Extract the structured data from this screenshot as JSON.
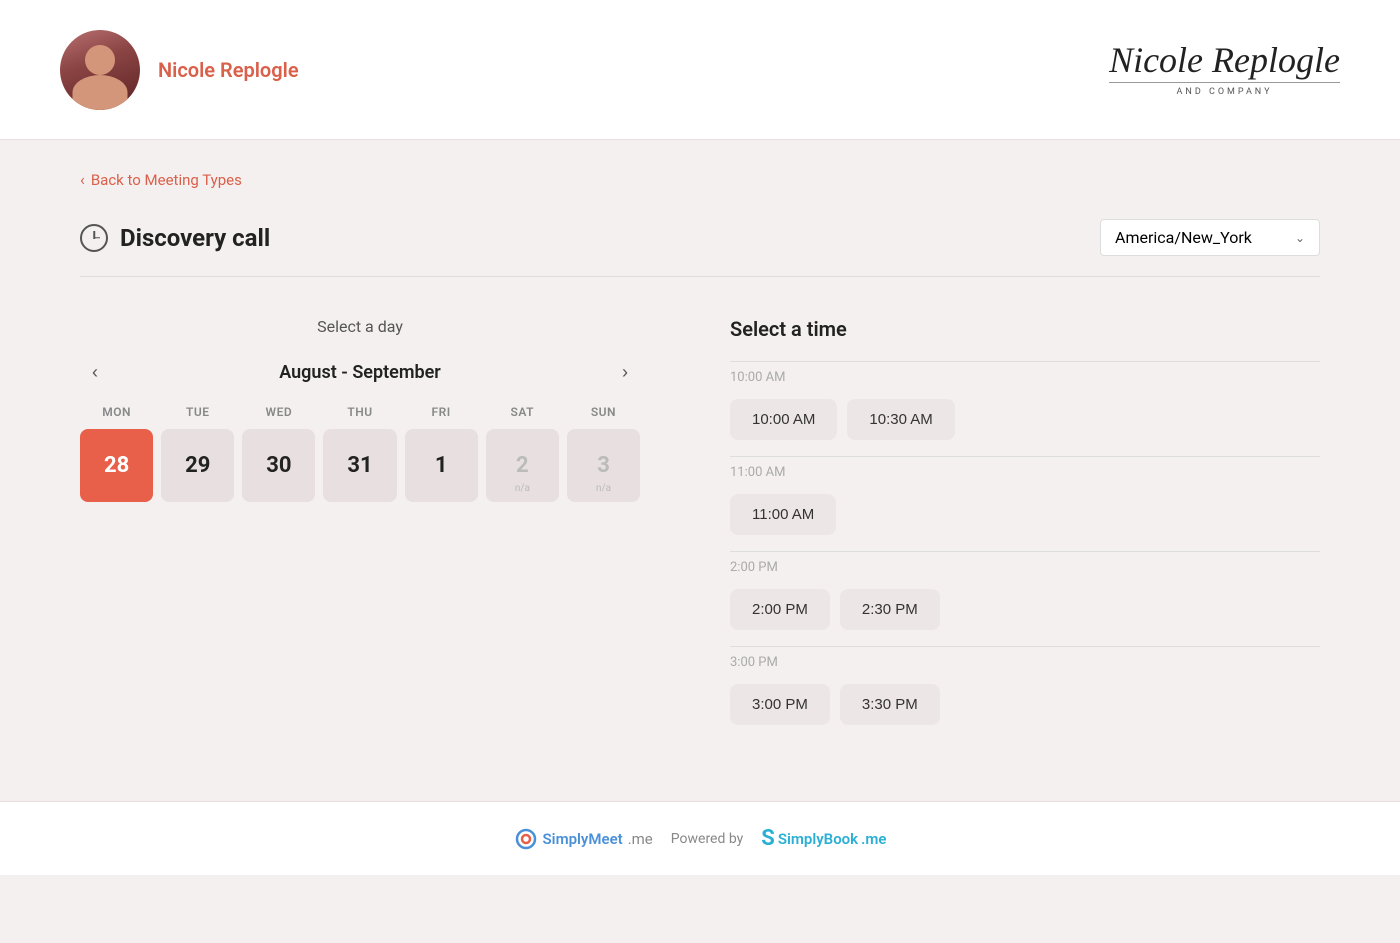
{
  "header": {
    "user_name": "Nicole Replogle",
    "logo_line1": "Nicole Replogle",
    "logo_line2": "AND COMPANY"
  },
  "navigation": {
    "back_label": "Back to Meeting Types"
  },
  "meeting": {
    "title": "Discovery call",
    "timezone_label": "America/New_York"
  },
  "calendar": {
    "select_day_label": "Select a day",
    "month_label": "August - September",
    "weekdays": [
      "MON",
      "TUE",
      "WED",
      "THU",
      "FRI",
      "SAT",
      "SUN"
    ],
    "days": [
      {
        "num": "28",
        "active": true,
        "na": false
      },
      {
        "num": "29",
        "active": false,
        "na": false
      },
      {
        "num": "30",
        "active": false,
        "na": false
      },
      {
        "num": "31",
        "active": false,
        "na": false
      },
      {
        "num": "1",
        "active": false,
        "na": false
      },
      {
        "num": "2",
        "active": false,
        "na": true
      },
      {
        "num": "3",
        "active": false,
        "na": true
      }
    ]
  },
  "time_picker": {
    "select_time_label": "Select a time",
    "groups": [
      {
        "header": "10:00 AM",
        "slots": [
          "10:00 AM",
          "10:30 AM"
        ]
      },
      {
        "header": "11:00 AM",
        "slots": [
          "11:00 AM"
        ]
      },
      {
        "header": "2:00 PM",
        "slots": [
          "2:00 PM",
          "2:30 PM"
        ]
      },
      {
        "header": "3:00 PM",
        "slots": [
          "3:00 PM",
          "3:30 PM"
        ]
      }
    ]
  },
  "footer": {
    "simplymeet_brand": "SimplyMeet",
    "simplymeet_suffix": ".me",
    "powered_by": "Powered by",
    "simplybook_brand": "SimplyBook",
    "simplybook_suffix": ".me"
  }
}
